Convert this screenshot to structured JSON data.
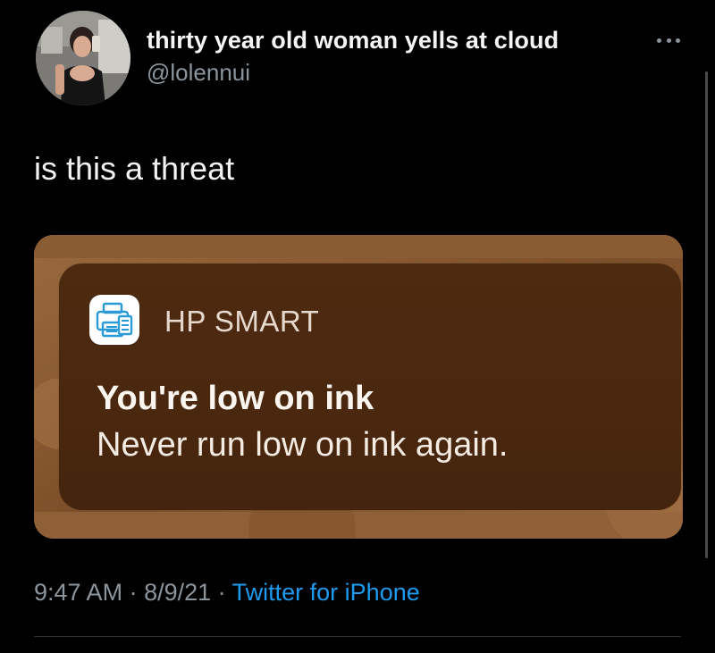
{
  "tweet": {
    "author": {
      "display_name": "thirty year old woman yells at cloud",
      "handle": "@lolennui",
      "avatar_icon": "profile-photo"
    },
    "more_icon": "ellipsis-icon",
    "text": "is this a threat",
    "media": {
      "notification": {
        "app_icon": "printer-icon",
        "app_name": "HP SMART",
        "title": "You're low on ink",
        "body": "Never run low on ink again."
      }
    },
    "meta": {
      "time": "9:47 AM",
      "separator_1": " · ",
      "date": "8/9/21",
      "separator_2": " · ",
      "source": "Twitter for iPhone"
    }
  },
  "colors": {
    "background": "#000000",
    "secondary_text": "#8c949c",
    "link": "#1d9bf0",
    "notification_bg": "#4a280f"
  }
}
